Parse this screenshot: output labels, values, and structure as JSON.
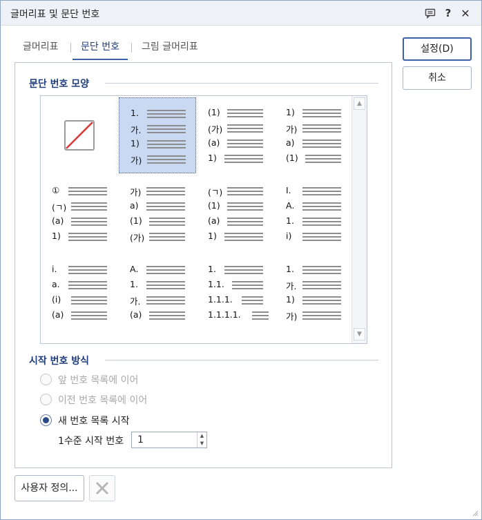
{
  "window": {
    "title": "글머리표 및 문단 번호"
  },
  "titlebar_icons": {
    "chat": "chat-icon",
    "help": "?",
    "close": "✕"
  },
  "tabs": [
    {
      "label": "글머리표",
      "active": false
    },
    {
      "label": "문단 번호",
      "active": true
    },
    {
      "label": "그림 글머리표",
      "active": false
    }
  ],
  "numbering_group": {
    "label": "문단 번호 모양"
  },
  "numbering_styles": [
    {
      "id": "none",
      "rows": []
    },
    {
      "id": "style-1",
      "selected": true,
      "rows": [
        "1.",
        "가.",
        "1)",
        "가)"
      ]
    },
    {
      "id": "style-2",
      "rows": [
        "(1)",
        "(가)",
        "(a)",
        "1)"
      ]
    },
    {
      "id": "style-3",
      "rows": [
        "1)",
        "가)",
        "a)",
        "(1)"
      ]
    },
    {
      "id": "style-4",
      "rows": [
        "①",
        "(ㄱ)",
        "(a)",
        "1)"
      ]
    },
    {
      "id": "style-5",
      "rows": [
        "가)",
        "a)",
        "(1)",
        "(가)"
      ]
    },
    {
      "id": "style-6",
      "rows": [
        "(ㄱ)",
        "(1)",
        "(a)",
        "1)"
      ]
    },
    {
      "id": "style-7",
      "rows": [
        "I.",
        "A.",
        "1.",
        "i)"
      ]
    },
    {
      "id": "style-8",
      "rows": [
        "i.",
        "a.",
        "(i)",
        "(a)"
      ]
    },
    {
      "id": "style-9",
      "rows": [
        "A.",
        "1.",
        "가.",
        "(a)"
      ]
    },
    {
      "id": "style-10",
      "rows": [
        "1.",
        "1.1.",
        "1.1.1.",
        "1.1.1.1."
      ]
    },
    {
      "id": "style-11",
      "rows": [
        "1.",
        "가.",
        "1)",
        "가)"
      ]
    }
  ],
  "start_group": {
    "label": "시작 번호 방식"
  },
  "radios": [
    {
      "label": "앞 번호 목록에 이어",
      "checked": false,
      "disabled": true
    },
    {
      "label": "이전 번호 목록에 이어",
      "checked": false,
      "disabled": true
    },
    {
      "label": "새 번호 목록 시작",
      "checked": true,
      "disabled": false
    }
  ],
  "start_number": {
    "label": "1수준 시작 번호",
    "value": "1"
  },
  "buttons": {
    "ok": "설정(D)",
    "cancel": "취소",
    "custom": "사용자 정의..."
  },
  "colors": {
    "accent": "#3b5fa8",
    "selected_bg": "#c9d9f2",
    "group_label": "#1f3d7a"
  }
}
